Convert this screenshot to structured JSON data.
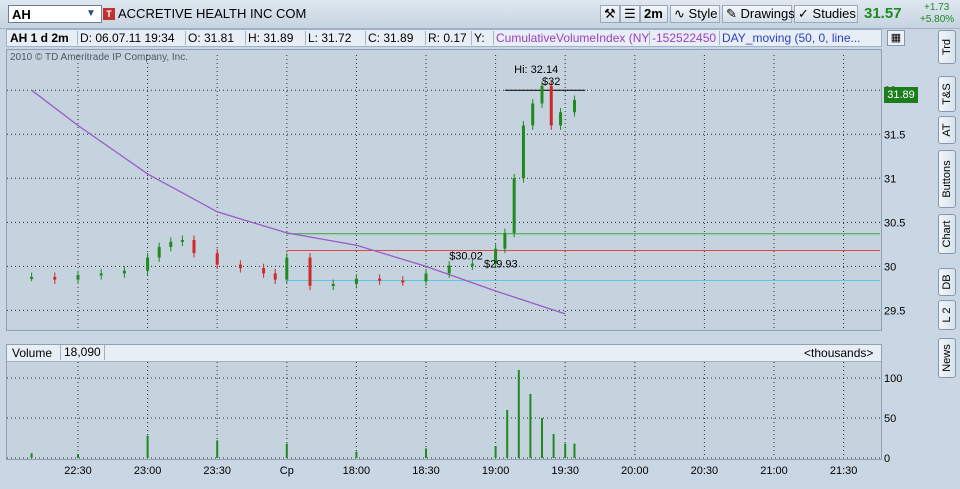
{
  "toolbar": {
    "symbol": "AH",
    "alert_icon": "T",
    "company_name": "ACCRETIVE HEALTH INC COM",
    "aggregation_label": "2m",
    "style_label": "Style",
    "drawings_label": "Drawings",
    "studies_label": "Studies",
    "last_price": "31.57",
    "net_change": "+1.73",
    "pct_change": "+5.80%",
    "icons": [
      "symbol-dropdown-icon",
      "alert-icon",
      "tools-icon",
      "link-icon",
      "style-icon",
      "pencil-icon",
      "studies-icon"
    ],
    "colors": {
      "up": "#1f8a1f",
      "alert": "#c0312d"
    }
  },
  "infobar": {
    "chart_label": "AH 1 d 2m",
    "date": "D: 06.07.11 19:34",
    "open": "O: 31.81",
    "high": "H: 31.89",
    "low": "L: 31.72",
    "close": "C: 31.89",
    "range": "R: 0.17",
    "y": "Y:",
    "study_name": "CumulativeVolumeIndex (NYSE)",
    "study_value": "-152522450",
    "moving_label": "DAY_moving (50, 0, line..."
  },
  "price_panel": {
    "copyright": "2010 © TD Ameritrade IP Company, Inc.",
    "current_price_label": "31.89",
    "annotations": [
      "Hi: 32.14",
      "$32",
      "$30.02",
      "$29.93"
    ]
  },
  "volume_panel": {
    "label": "Volume",
    "value": "18,090",
    "units": "<thousands>"
  },
  "side_tabs": [
    "Trd",
    "T&S",
    "AT",
    "Buttons",
    "Chart",
    "DB",
    "L 2",
    "News"
  ],
  "chart_data": [
    {
      "type": "line",
      "title": "",
      "x_tick_labels": [
        "22:30",
        "23:00",
        "23:30",
        "Cp",
        "18:00",
        "18:30",
        "19:00",
        "19:30",
        "20:00",
        "20:30",
        "21:00",
        "21:30"
      ],
      "y_tick_labels": [
        "32",
        "31.5",
        "31",
        "30.5",
        "30",
        "29.5"
      ],
      "ylim": [
        29.3,
        32.4
      ],
      "grid": true,
      "series": [
        {
          "name": "AH",
          "color": "#e03030",
          "x": [
            "22:10",
            "22:20",
            "22:30",
            "22:40",
            "22:50",
            "23:00",
            "23:05",
            "23:10",
            "23:15",
            "23:20",
            "23:30",
            "23:40",
            "23:50",
            "23:55",
            "Cp",
            "17:40",
            "17:50",
            "18:00",
            "18:10",
            "18:20",
            "18:30",
            "18:40",
            "18:50",
            "19:00",
            "19:04",
            "19:08",
            "19:12",
            "19:16",
            "19:20",
            "19:24",
            "19:28",
            "19:34"
          ],
          "values": [
            29.88,
            29.85,
            29.9,
            29.92,
            29.95,
            30.1,
            30.22,
            30.28,
            30.3,
            30.15,
            30.02,
            29.98,
            29.92,
            29.85,
            30.1,
            29.78,
            29.8,
            29.86,
            29.84,
            29.83,
            29.92,
            30.01,
            30.03,
            30.2,
            30.38,
            31.0,
            31.6,
            31.85,
            32.05,
            31.6,
            31.75,
            31.89
          ]
        },
        {
          "name": "DAY_moving (50, 0, line...",
          "color": "#9a5bc8",
          "x": [
            "22:10",
            "22:30",
            "23:00",
            "23:30",
            "Cp",
            "18:00",
            "18:30",
            "19:00",
            "19:30"
          ],
          "values": [
            32.0,
            31.6,
            31.05,
            30.62,
            30.38,
            30.24,
            30.0,
            29.72,
            29.46
          ]
        }
      ],
      "horizontal_levels": [
        {
          "value": 30.37,
          "color": "#3aa83a"
        },
        {
          "value": 30.18,
          "color": "#e04848"
        },
        {
          "value": 29.84,
          "color": "#5fc3e6"
        },
        {
          "value": 32.0,
          "color": "#000000"
        }
      ],
      "annotations": [
        {
          "text": "Hi: 32.14",
          "value": 32.14
        },
        {
          "text": "$32",
          "value": 32.0
        },
        {
          "text": "$30.02",
          "value": 30.02
        },
        {
          "text": "$29.93",
          "value": 29.93
        }
      ]
    },
    {
      "type": "bar",
      "title": "",
      "y_tick_labels": [
        "100",
        "50",
        "0"
      ],
      "ylim": [
        0,
        120
      ],
      "grid": true,
      "units": "<thousands>",
      "x": [
        "22:10",
        "22:30",
        "23:00",
        "23:30",
        "Cp",
        "18:00",
        "18:30",
        "19:00",
        "19:05",
        "19:10",
        "19:15",
        "19:20",
        "19:25",
        "19:30",
        "19:34"
      ],
      "values": [
        6,
        5,
        28,
        22,
        18,
        8,
        12,
        15,
        60,
        110,
        80,
        50,
        30,
        18,
        18
      ],
      "color": "#1f8a1f"
    }
  ]
}
